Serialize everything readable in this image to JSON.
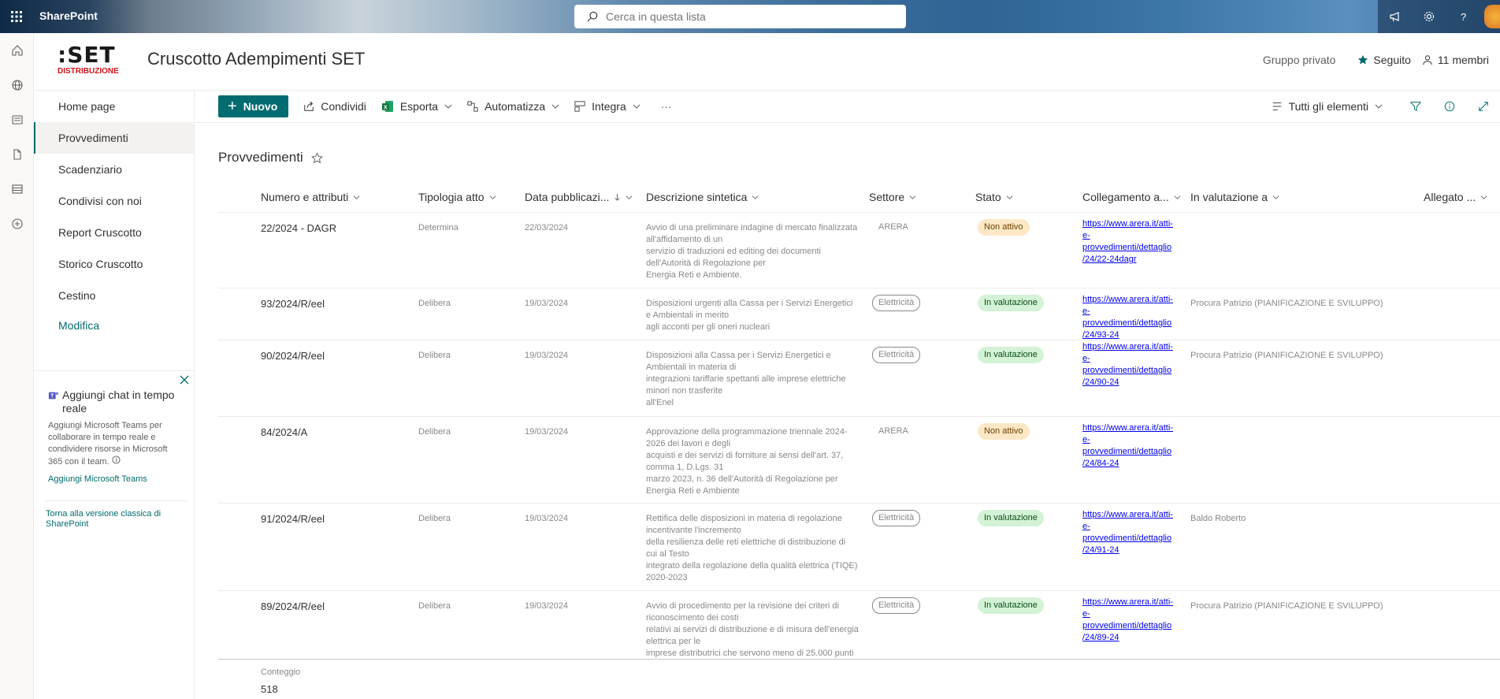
{
  "suitebar": {
    "brand": "SharePoint",
    "search_placeholder": "Cerca in questa lista"
  },
  "site": {
    "logo_top": ":SET",
    "logo_bottom": "DISTRIBUZIONE",
    "title": "Cruscotto Adempimenti SET",
    "group_type": "Gruppo privato",
    "follow_label": "Seguito",
    "members_label": "11 membri"
  },
  "nav": {
    "items": [
      "Home page",
      "Provvedimenti",
      "Scadenziario",
      "Condivisi con noi",
      "Report Cruscotto",
      "Storico Cruscotto",
      "Cestino"
    ],
    "edit_label": "Modifica"
  },
  "teams_card": {
    "title": "Aggiungi chat in tempo reale",
    "description": "Aggiungi Microsoft Teams per collaborare in tempo reale e condividere risorse in Microsoft 365 con il team.",
    "link": "Aggiungi Microsoft Teams"
  },
  "classic_link": "Torna alla versione classica di SharePoint",
  "commands": {
    "new": "Nuovo",
    "share": "Condividi",
    "export": "Esporta",
    "automate": "Automatizza",
    "integrate": "Integra",
    "more": "···",
    "view": "Tutti gli elementi"
  },
  "list": {
    "title": "Provvedimenti",
    "columns": [
      "Numero e attributi",
      "Tipologia atto",
      "Data pubblicazi...",
      "Descrizione sintetica",
      "Settore",
      "Stato",
      "Collegamento a...",
      "In valutazione a",
      "Allegato ..."
    ],
    "rows": [
      {
        "num": "22/2024 - DAGR",
        "tipologia": "Determina",
        "data": "22/03/2024",
        "descrizione": "Avvio di una preliminare indagine di mercato finalizzata all'affidamento di un\nservizio di traduzioni ed editing dei documenti dell'Autorità di Regolazione per\nEnergia Reti e Ambiente.",
        "settore": "ARERA",
        "stato": "Non attivo",
        "link": [
          "https://www.arera.it/atti-",
          "e-",
          "provvedimenti/dettaglio",
          "/24/22-24dagr"
        ],
        "valutazione": ""
      },
      {
        "num": "93/2024/R/eel",
        "tipologia": "Delibera",
        "data": "19/03/2024",
        "descrizione": "Disposizioni urgenti alla Cassa per i Servizi Energetici e Ambientali in merito\nagli acconti per gli oneri nucleari",
        "settore": "Elettricità",
        "stato": "In valutazione",
        "link": [
          "https://www.arera.it/atti-",
          "e-",
          "provvedimenti/dettaglio",
          "/24/93-24"
        ],
        "valutazione": "Procura Patrizio (PIANIFICAZIONE E SVILUPPO)"
      },
      {
        "num": "90/2024/R/eel",
        "tipologia": "Delibera",
        "data": "19/03/2024",
        "descrizione": "Disposizioni alla Cassa per i Servizi Energetici e Ambientali in materia di\nintegrazioni tariffarie spettanti alle imprese elettriche minori non trasferite\nall'Enel",
        "settore": "Elettricità",
        "stato": "In valutazione",
        "link": [
          "https://www.arera.it/atti-",
          "e-",
          "provvedimenti/dettaglio",
          "/24/90-24"
        ],
        "valutazione": "Procura Patrizio (PIANIFICAZIONE E SVILUPPO)"
      },
      {
        "num": "84/2024/A",
        "tipologia": "Delibera",
        "data": "19/03/2024",
        "descrizione": "Approvazione della programmazione triennale 2024-2026 dei lavori e degli\nacquisti e dei servizi di forniture ai sensi dell'art. 37, comma 1, D.Lgs. 31\nmarzo 2023, n. 36 dell'Autorità di Regolazione per Energia Reti e Ambiente",
        "settore": "ARERA",
        "stato": "Non attivo",
        "link": [
          "https://www.arera.it/atti-",
          "e-",
          "provvedimenti/dettaglio",
          "/24/84-24"
        ],
        "valutazione": ""
      },
      {
        "num": "91/2024/R/eel",
        "tipologia": "Delibera",
        "data": "19/03/2024",
        "descrizione": "Rettifica delle disposizioni in materia di regolazione incentivante l'incremento\ndella resilienza delle reti elettriche di distribuzione di cui al Testo\nintegrato della regolazione della qualità elettrica (TIQE) 2020-2023",
        "settore": "Elettricità",
        "stato": "In valutazione",
        "link": [
          "https://www.arera.it/atti-",
          "e-",
          "provvedimenti/dettaglio",
          "/24/91-24"
        ],
        "valutazione": "Baldo Roberto"
      },
      {
        "num": "89/2024/R/eel",
        "tipologia": "Delibera",
        "data": "19/03/2024",
        "descrizione": "Avvio di procedimento per la revisione dei criteri di riconoscimento dei costi\nrelativi ai servizi di distribuzione e di misura dell'energia elettrica per le\nimprese distributrici che servono meno di 25.000 punti",
        "settore": "Elettricità",
        "stato": "In valutazione",
        "link": [
          "https://www.arera.it/atti-",
          "e-",
          "provvedimenti/dettaglio",
          "/24/89-24"
        ],
        "valutazione": "Procura Patrizio (PIANIFICAZIONE E SVILUPPO)"
      }
    ]
  },
  "footer": {
    "count_label": "Conteggio",
    "count_value": "518"
  },
  "colors": {
    "accent": "#036c70",
    "status_off": "#fde7c5",
    "status_eval": "#d3f2d6",
    "logo_red": "#d0131b"
  }
}
